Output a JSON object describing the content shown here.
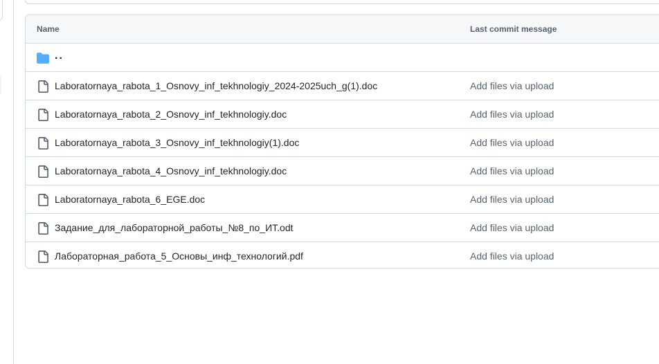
{
  "table": {
    "header": {
      "name_label": "Name",
      "message_label": "Last commit message"
    },
    "parent_dir": {
      "label": "..",
      "icon": "folder-icon"
    },
    "rows": [
      {
        "name": "Laboratornaya_rabota_1_Osnovy_inf_tekhnologiy_2024-2025uch_g(1).doc",
        "message": "Add files via upload",
        "icon": "file-icon"
      },
      {
        "name": "Laboratornaya_rabota_2_Osnovy_inf_tekhnologiy.doc",
        "message": "Add files via upload",
        "icon": "file-icon"
      },
      {
        "name": "Laboratornaya_rabota_3_Osnovy_inf_tekhnologiy(1).doc",
        "message": "Add files via upload",
        "icon": "file-icon"
      },
      {
        "name": "Laboratornaya_rabota_4_Osnovy_inf_tekhnologiy.doc",
        "message": "Add files via upload",
        "icon": "file-icon"
      },
      {
        "name": "Laboratornaya_rabota_6_EGE.doc",
        "message": "Add files via upload",
        "icon": "file-icon"
      },
      {
        "name": "Задание_для_лабораторной_работы_№8_по_ИТ.odt",
        "message": "Add files via upload",
        "icon": "file-icon"
      },
      {
        "name": "Лабораторная_работа_5_Основы_инф_технологий.pdf",
        "message": "Add files via upload",
        "icon": "file-icon"
      }
    ]
  },
  "colors": {
    "folder": "#54aeff",
    "border": "#d1d9e0",
    "muted_text": "#59636e",
    "header_bg": "#f6f8fa"
  }
}
